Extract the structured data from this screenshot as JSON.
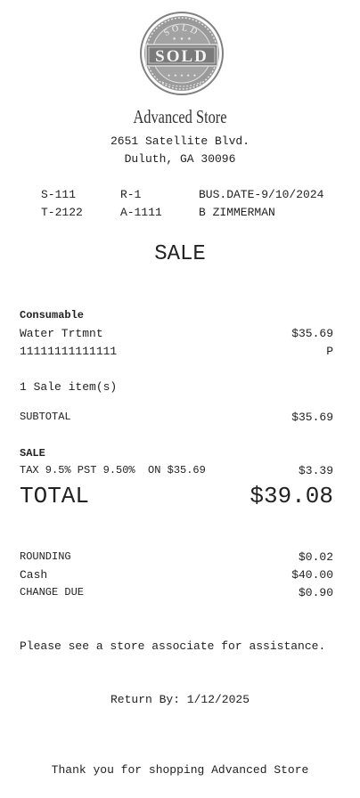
{
  "logo": {
    "top_text": "SOLD",
    "main_text": "SOLD",
    "color": "#7a7a7a"
  },
  "store": {
    "name": "Advanced Store",
    "address_line1": "2651 Satellite Blvd.",
    "address_line2": "Duluth, GA 30096"
  },
  "header_info": {
    "row1": {
      "store": "S-111",
      "register": "R-1",
      "bus_date": "BUS.DATE-9/10/2024"
    },
    "row2": {
      "transaction": "T-2122",
      "associate_id": "A-1111",
      "associate_name": "B ZIMMERMAN"
    }
  },
  "sale_title": "SALE",
  "items": {
    "category": "Consumable",
    "name": "Water Trtmnt",
    "price": "$35.69",
    "sku": "11111111111111",
    "flag": "P",
    "count_text": "1 Sale item(s)"
  },
  "subtotal": {
    "label": "SUBTOTAL",
    "value": "$35.69"
  },
  "tax_section": {
    "heading": "SALE",
    "label": "TAX 9.5% PST 9.50%  ON $35.69",
    "value": "$3.39"
  },
  "total": {
    "label": "TOTAL",
    "value": "$39.08"
  },
  "payment": {
    "rounding_label": "ROUNDING",
    "rounding_value": "$0.02",
    "cash_label": "Cash",
    "cash_value": "$40.00",
    "change_label": "CHANGE DUE",
    "change_value": "$0.90"
  },
  "footer": {
    "assist_note": "Please see a store associate for assistance.",
    "return_by": "Return By: 1/12/2025",
    "thanks": "Thank you for shopping Advanced Store"
  }
}
